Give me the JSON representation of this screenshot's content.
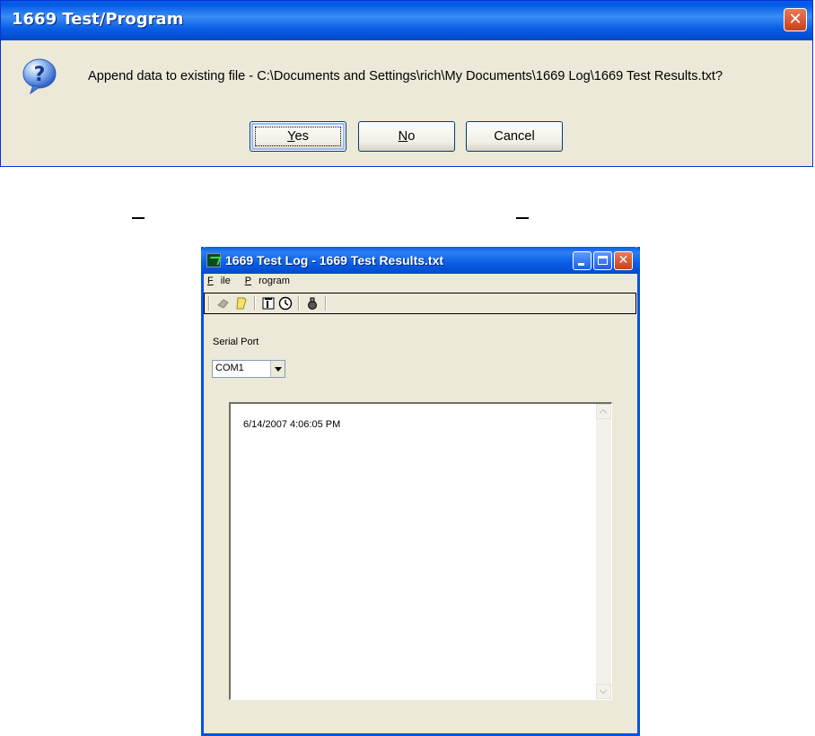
{
  "dialog": {
    "title": "1669 Test/Program",
    "message": "Append data to existing file - C:\\Documents and Settings\\rich\\My Documents\\1669 Log\\1669 Test Results.txt?",
    "buttons": {
      "yes": {
        "accel": "Y",
        "rest": "es"
      },
      "no": {
        "accel": "N",
        "rest": "o"
      },
      "cancel": "Cancel"
    },
    "close_glyph": "✕"
  },
  "app": {
    "title": "1669 Test Log - 1669 Test Results.txt",
    "menu": {
      "file": {
        "accel": "F",
        "rest": "ile"
      },
      "program": {
        "accel": "P",
        "rest": "rogram"
      }
    },
    "toolbar_icons": [
      "eraser-icon",
      "new-page-icon",
      "document-icon",
      "clock-icon",
      "probe-icon"
    ],
    "serial_port": {
      "label": "Serial Port",
      "selected": "COM1"
    },
    "log": {
      "lines": [
        "6/14/2007 4:06:05 PM"
      ]
    },
    "close_glyph": "✕"
  },
  "colors": {
    "titlebar": "#0a5fe6",
    "dialog_bg": "#ece9d8",
    "close_red": "#d9552f"
  }
}
